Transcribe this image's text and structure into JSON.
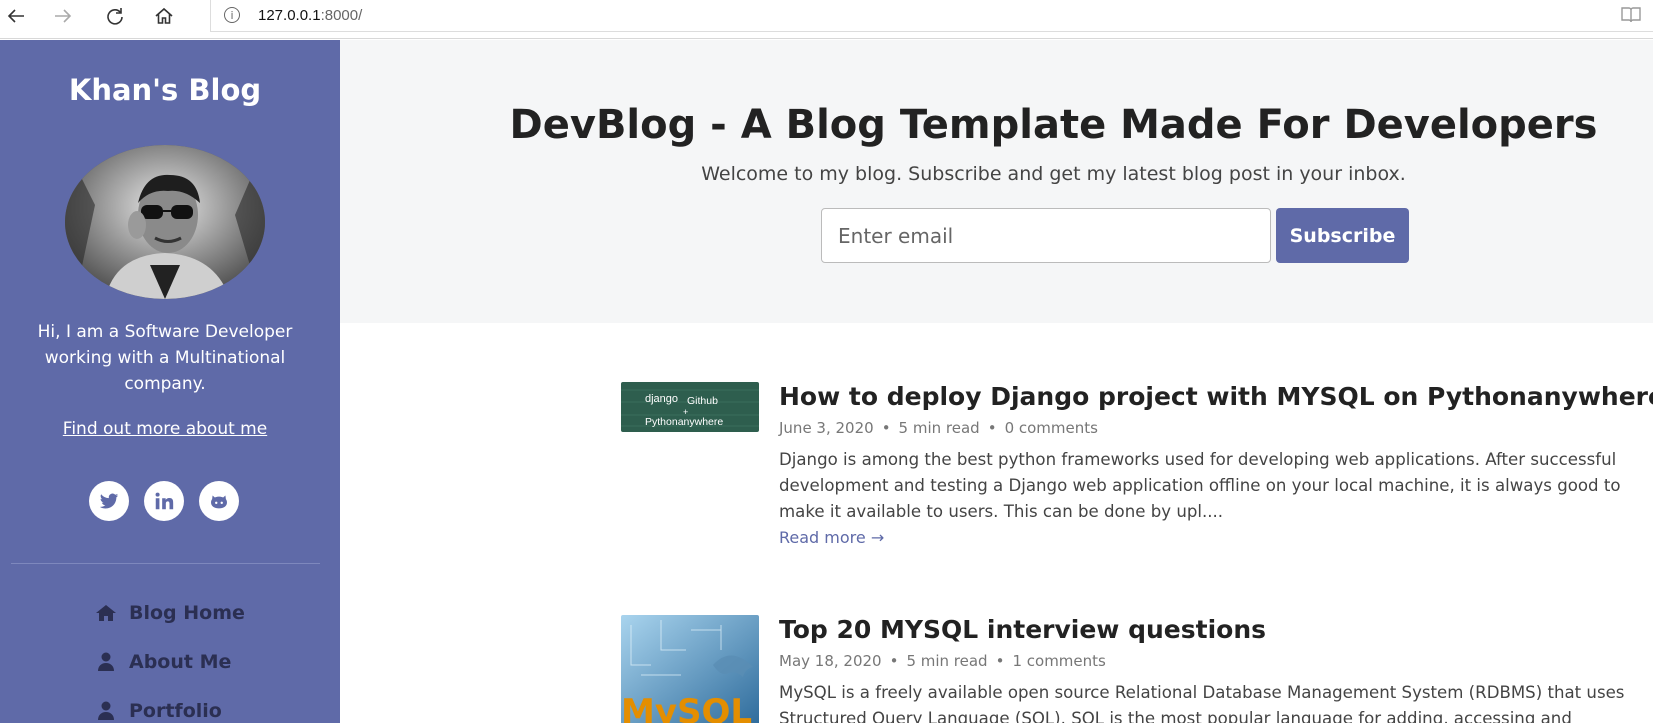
{
  "browser": {
    "url_host": "127.0.0.1",
    "url_rest": ":8000/",
    "icons": [
      "back-arrow-icon",
      "forward-arrow-icon",
      "refresh-icon",
      "home-icon",
      "info-icon",
      "reading-view-icon"
    ]
  },
  "sidebar": {
    "blog_name": "Khan's Blog",
    "bio": "Hi, I am a Software Developer working with a Multinational company.",
    "more_link": "Find out more about me",
    "social_icons": [
      "twitter-icon",
      "linkedin-icon",
      "github-icon"
    ],
    "nav": [
      {
        "label": "Blog Home",
        "icon": "home-icon"
      },
      {
        "label": "About Me",
        "icon": "user-icon"
      },
      {
        "label": "Portfolio",
        "icon": "user-icon"
      }
    ],
    "background_color": "#5f6aa8"
  },
  "hero": {
    "title": "DevBlog - A Blog Template Made For Developers",
    "subtitle": "Welcome to my blog. Subscribe and get my latest blog post in your inbox.",
    "email_placeholder": "Enter email",
    "subscribe_label": "Subscribe",
    "accent_color": "#5f6aa8"
  },
  "posts": [
    {
      "title": "How to deploy Django project with MYSQL on Pythonanywhere",
      "date": "June 3, 2020",
      "read_time": "5 min read",
      "comments": "0 comments",
      "excerpt": "Django is among the best python frameworks used for developing web applications. After successful development and testing a Django web application offline on your local machine, it is always good to make it available to users. This can be done by upl....",
      "read_more": "Read more →",
      "thumb_text": [
        "django",
        "Github",
        "+",
        "Pythonanywhere"
      ]
    },
    {
      "title": "Top 20 MYSQL interview questions",
      "date": "May 18, 2020",
      "read_time": "5 min read",
      "comments": "1 comments",
      "excerpt": "MySQL is a freely available open source Relational Database Management System (RDBMS) that uses Structured Query Language (SQL). SQL is the most popular language for adding, accessing and managing",
      "thumb_text": [
        "MySQL"
      ]
    }
  ]
}
